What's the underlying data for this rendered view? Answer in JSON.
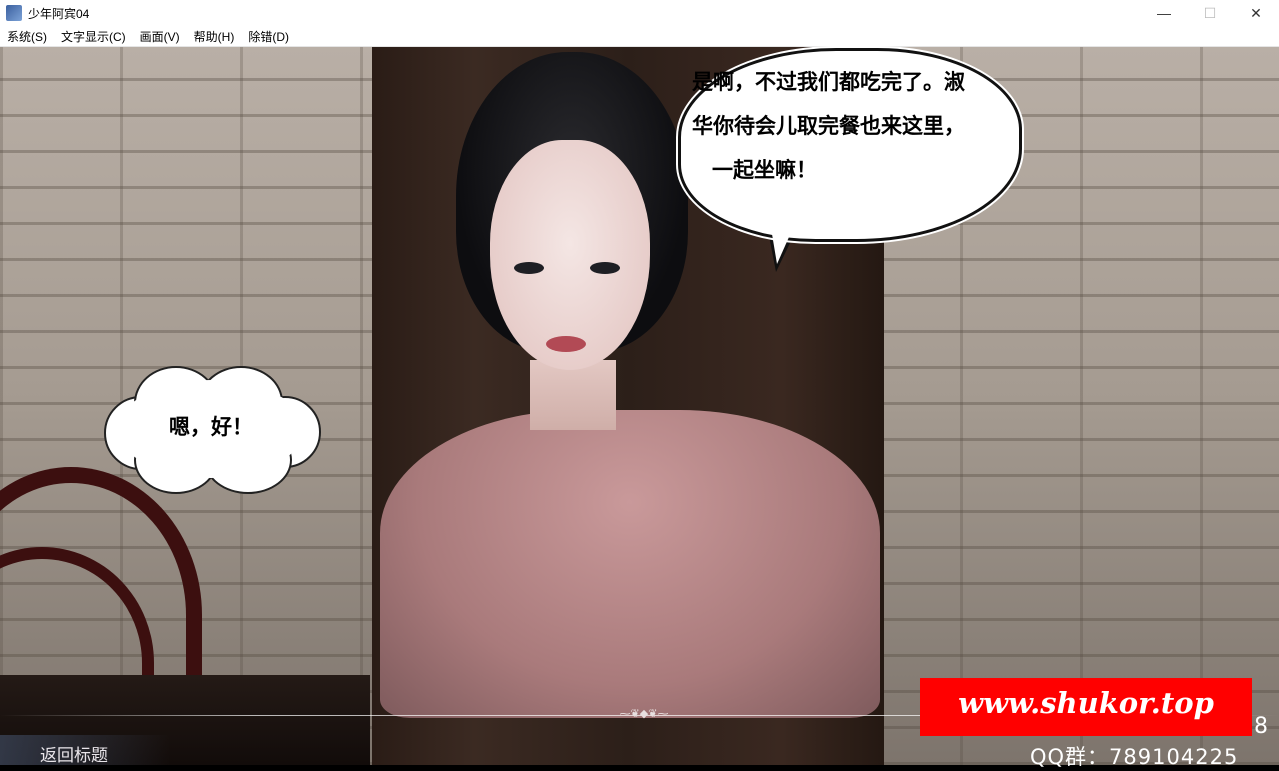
{
  "window": {
    "title": "少年阿宾04",
    "controls": {
      "minimize": "—",
      "maximize": "☐",
      "close": "✕"
    }
  },
  "menu": [
    {
      "label": "系统(S)"
    },
    {
      "label": "文字显示(C)"
    },
    {
      "label": "画面(V)"
    },
    {
      "label": "帮助(H)"
    },
    {
      "label": "除错(D)"
    }
  ],
  "dialogue": {
    "right_bubble": {
      "line1": "是啊，不过我们都吃完了。淑",
      "line2": "华你待会儿取完餐也来这里，",
      "line3": "一起坐嘛！"
    },
    "left_bubble": "嗯，好！"
  },
  "ui": {
    "return_title": "返回标题"
  },
  "watermark": {
    "url": "www.shukor.top",
    "qq": "QQ群：789104225",
    "partial_digit": "8"
  },
  "colors": {
    "watermark_bg": "#ff0000",
    "bubble_border": "#111111"
  }
}
